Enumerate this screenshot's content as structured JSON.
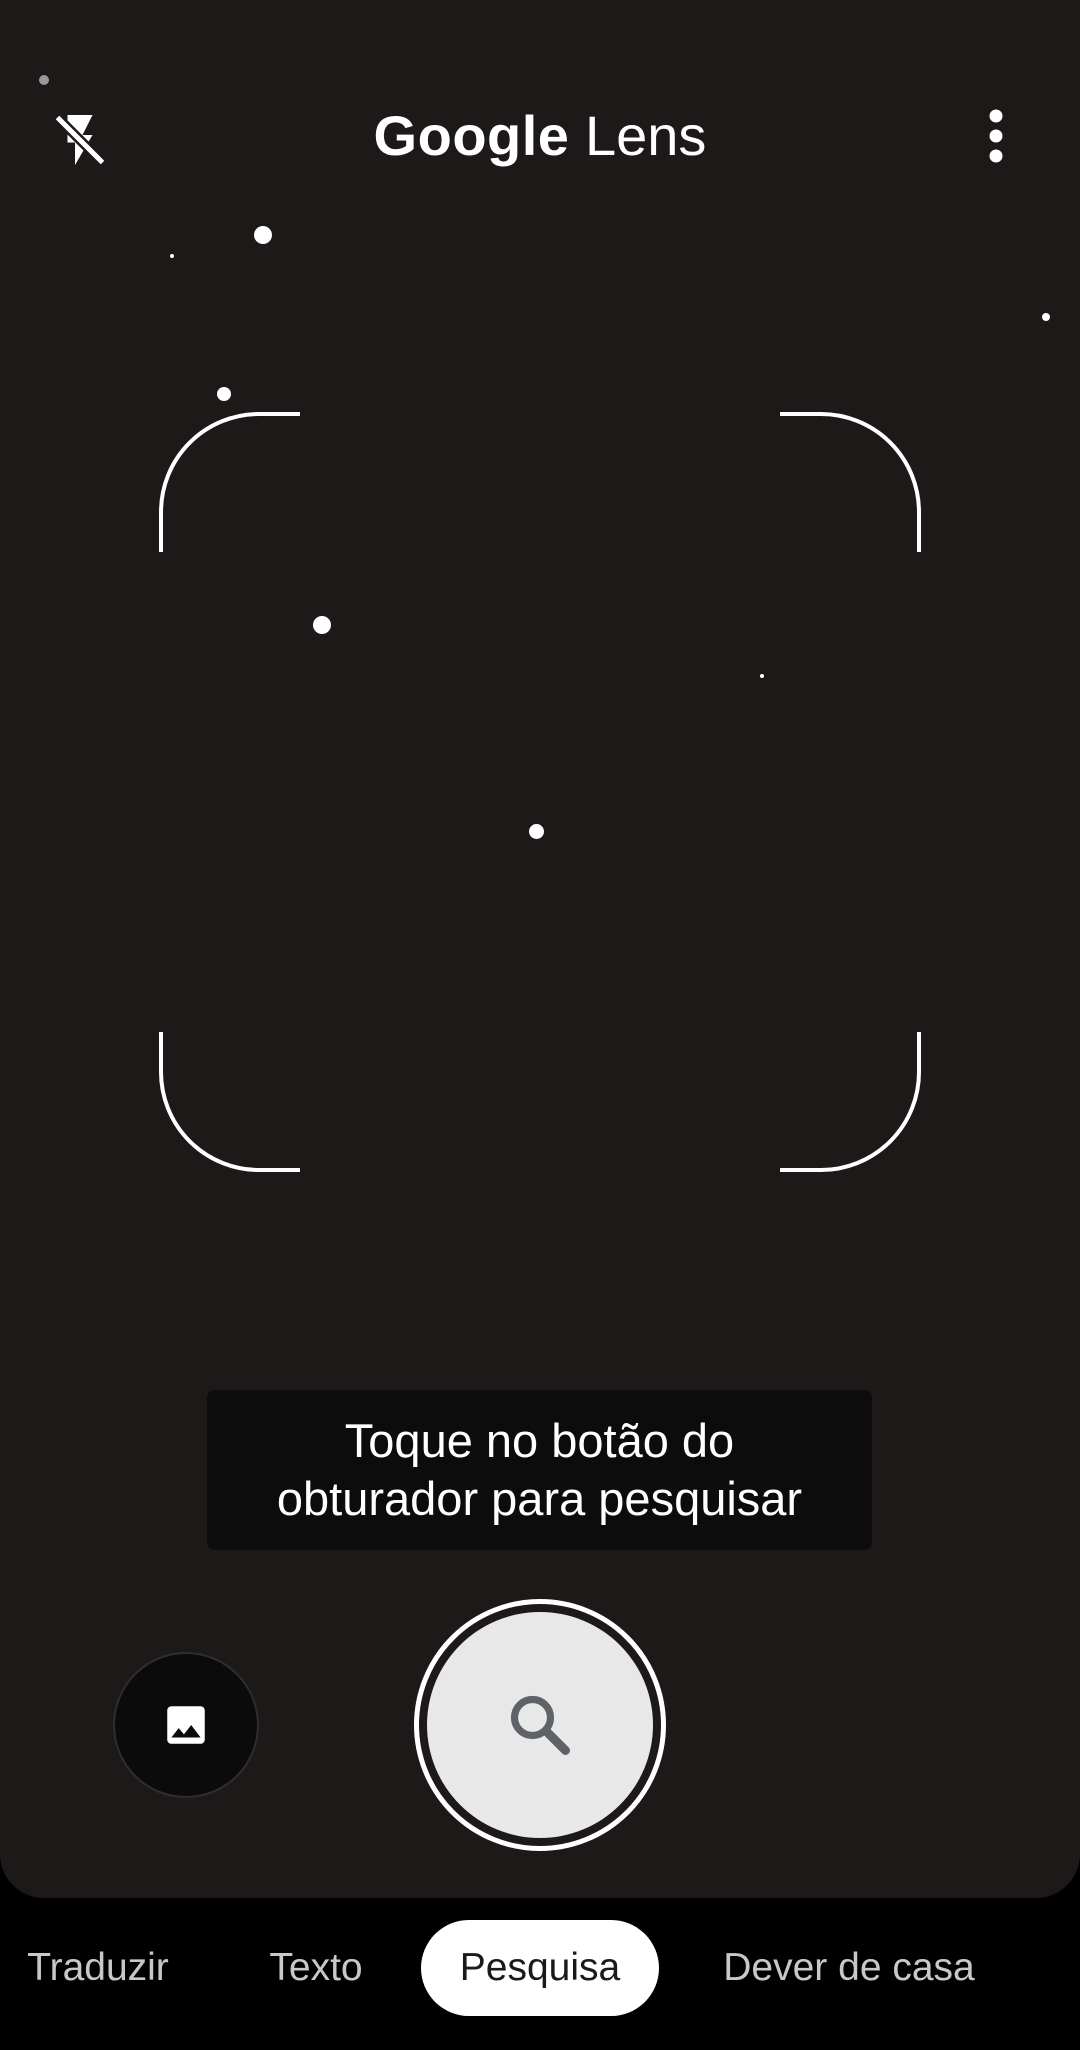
{
  "app": {
    "title_brand": "Google",
    "title_product": "Lens"
  },
  "icons": {
    "flash": "flash-off-icon",
    "menu": "more-vert-icon",
    "gallery": "image-icon",
    "shutter": "search-icon"
  },
  "hint": {
    "line1": "Toque no botão do",
    "line2": "obturador para pesquisar"
  },
  "modes": [
    {
      "label": "Traduzir",
      "active": false
    },
    {
      "label": "Texto",
      "active": false
    },
    {
      "label": "Pesquisa",
      "active": true
    },
    {
      "label": "Dever de casa",
      "active": false
    }
  ],
  "colors": {
    "viewfinder_background": "#1d1919",
    "accent": "#ffffff",
    "shutter_fill": "#e8e8e8",
    "inactive_tab_text": "#c8c8c8"
  }
}
